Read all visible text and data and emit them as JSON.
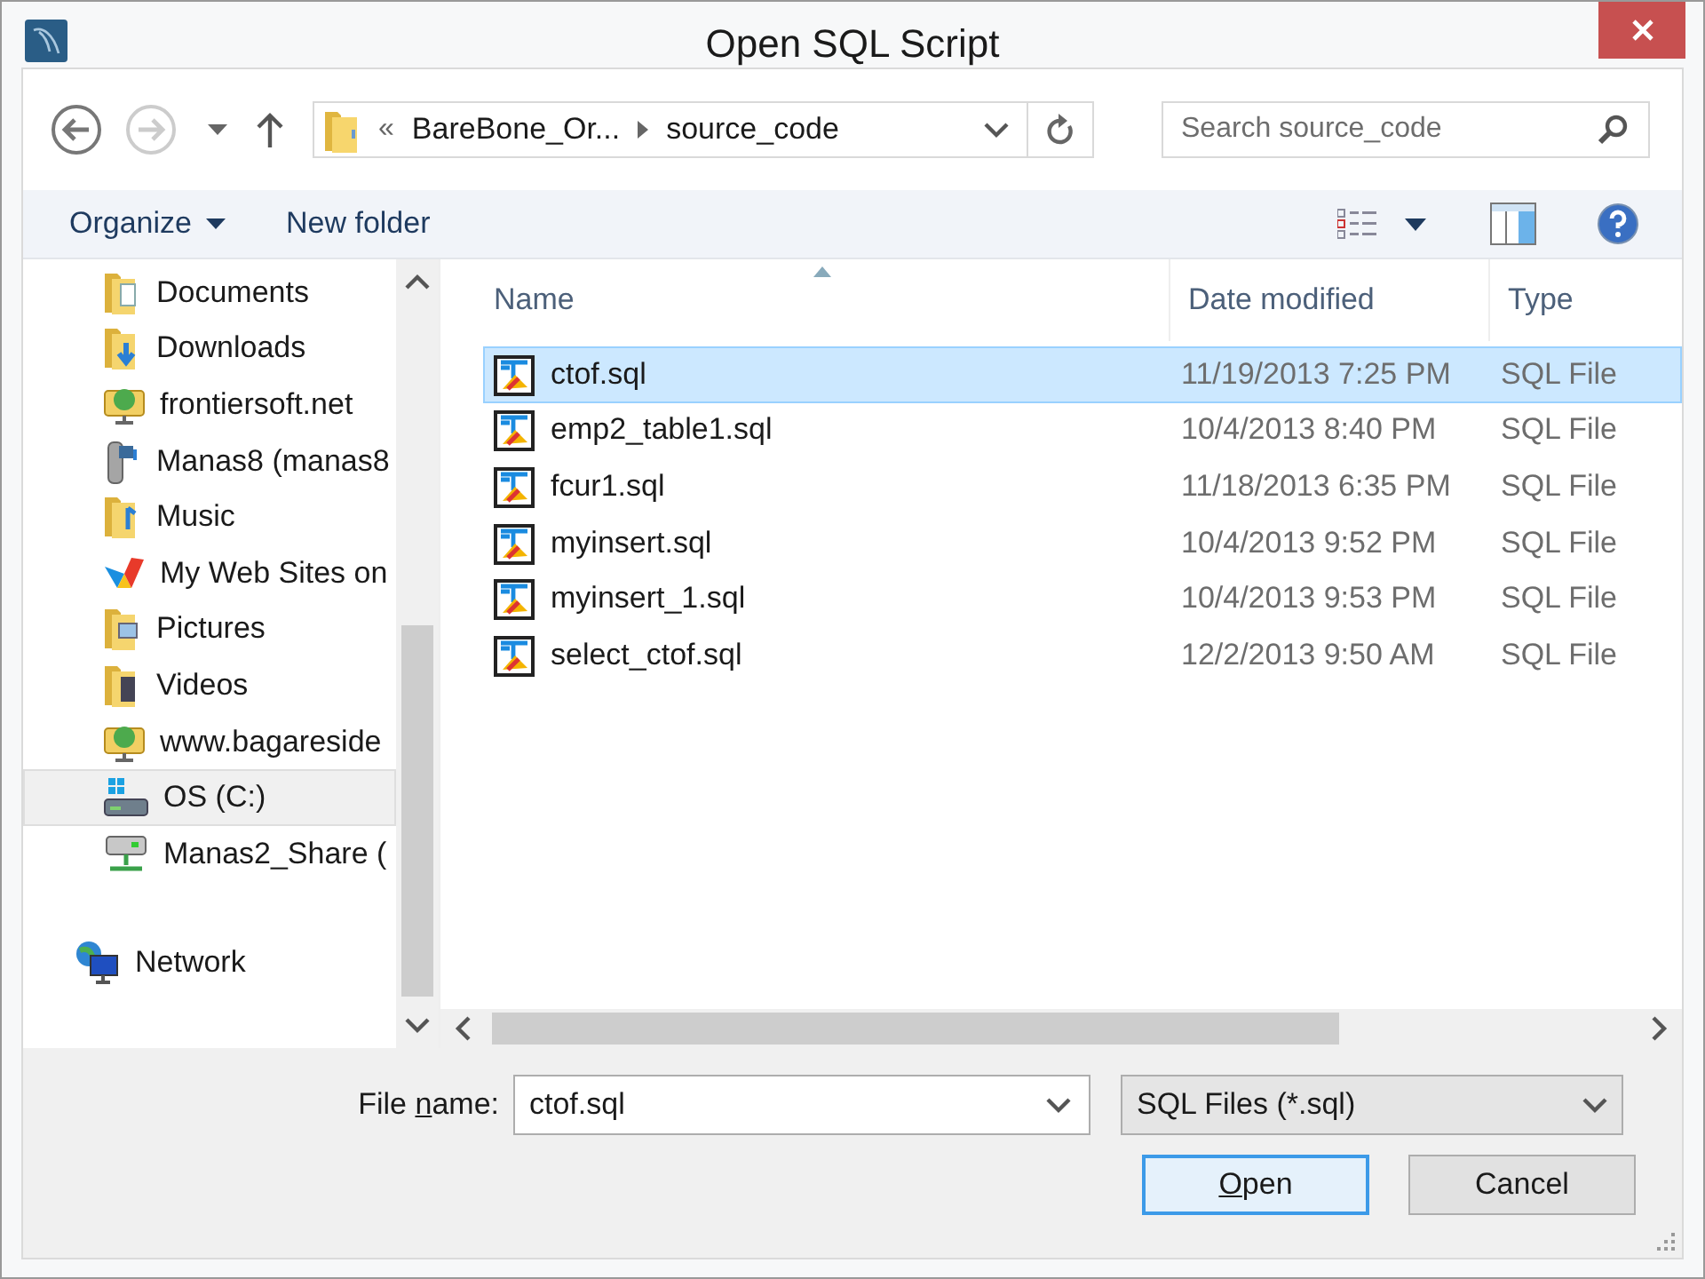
{
  "window": {
    "title": "Open SQL Script"
  },
  "nav": {
    "back_disabled": false,
    "forward_disabled": true
  },
  "address": {
    "overflow": "«",
    "crumbs": [
      "BareBone_Or...",
      "source_code"
    ]
  },
  "search": {
    "placeholder": "Search source_code"
  },
  "toolbar": {
    "buttons": [
      {
        "label": "Organize",
        "dropdown": true
      },
      {
        "label": "New folder",
        "dropdown": false
      }
    ]
  },
  "sidebar": {
    "items": [
      {
        "label": "Documents",
        "kind": "documents",
        "selected": false
      },
      {
        "label": "Downloads",
        "kind": "downloads",
        "selected": false
      },
      {
        "label": "frontiersoft.net",
        "kind": "web-location",
        "selected": false
      },
      {
        "label": "Manas8 (manas8",
        "kind": "device",
        "selected": false
      },
      {
        "label": "Music",
        "kind": "music",
        "selected": false
      },
      {
        "label": "My Web Sites on",
        "kind": "web-sites",
        "selected": false
      },
      {
        "label": "Pictures",
        "kind": "pictures",
        "selected": false
      },
      {
        "label": "Videos",
        "kind": "videos",
        "selected": false
      },
      {
        "label": "www.bagareside",
        "kind": "web-location",
        "selected": false
      },
      {
        "label": "OS (C:)",
        "kind": "drive",
        "selected": true
      },
      {
        "label": "Manas2_Share (",
        "kind": "network-drive",
        "selected": false
      },
      {
        "label": "Network",
        "kind": "network",
        "selected": false
      }
    ]
  },
  "files": {
    "columns": [
      "Name",
      "Date modified",
      "Type"
    ],
    "rows": [
      {
        "name": "ctof.sql",
        "date": "11/19/2013 7:25 PM",
        "type": "SQL File",
        "selected": true
      },
      {
        "name": "emp2_table1.sql",
        "date": "10/4/2013 8:40 PM",
        "type": "SQL File",
        "selected": false
      },
      {
        "name": "fcur1.sql",
        "date": "11/18/2013 6:35 PM",
        "type": "SQL File",
        "selected": false
      },
      {
        "name": "myinsert.sql",
        "date": "10/4/2013 9:52 PM",
        "type": "SQL File",
        "selected": false
      },
      {
        "name": "myinsert_1.sql",
        "date": "10/4/2013 9:53 PM",
        "type": "SQL File",
        "selected": false
      },
      {
        "name": "select_ctof.sql",
        "date": "12/2/2013 9:50 AM",
        "type": "SQL File",
        "selected": false
      }
    ]
  },
  "file_name": {
    "label": [
      {
        "text": "File ",
        "underline": false
      },
      {
        "text": "n",
        "underline": true
      },
      {
        "text": "ame:",
        "underline": false
      }
    ],
    "value": "ctof.sql"
  },
  "filter": {
    "value": "SQL Files (*.sql)"
  },
  "buttons": [
    {
      "parts": [
        {
          "text": "O",
          "underline": true
        },
        {
          "text": "pen",
          "underline": false
        }
      ],
      "default": true
    },
    {
      "parts": [
        {
          "text": "Cancel",
          "underline": false
        }
      ],
      "default": false
    }
  ]
}
